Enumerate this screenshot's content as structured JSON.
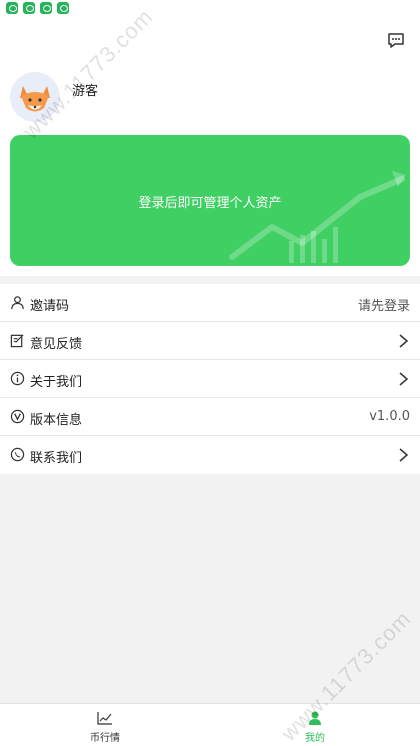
{
  "profile": {
    "username": "游客"
  },
  "asset_card": {
    "message": "登录后即可管理个人资产"
  },
  "menu": {
    "items": [
      {
        "label": "邀请码",
        "value": "请先登录",
        "icon": "user-icon"
      },
      {
        "label": "意见反馈",
        "value": "",
        "icon": "edit-icon"
      },
      {
        "label": "关于我们",
        "value": "",
        "icon": "info-icon"
      },
      {
        "label": "版本信息",
        "value": "v1.0.0",
        "icon": "version-icon"
      },
      {
        "label": "联系我们",
        "value": "",
        "icon": "phone-icon"
      }
    ]
  },
  "tabbar": {
    "tabs": [
      {
        "label": "币行情",
        "icon": "chart-icon",
        "active": false
      },
      {
        "label": "我的",
        "icon": "person-icon",
        "active": true
      }
    ]
  },
  "watermark": {
    "text": "www.11773.com"
  },
  "colors": {
    "accent": "#3fcf63",
    "active_tab": "#2fbf5a",
    "background": "#f2f2f2"
  }
}
